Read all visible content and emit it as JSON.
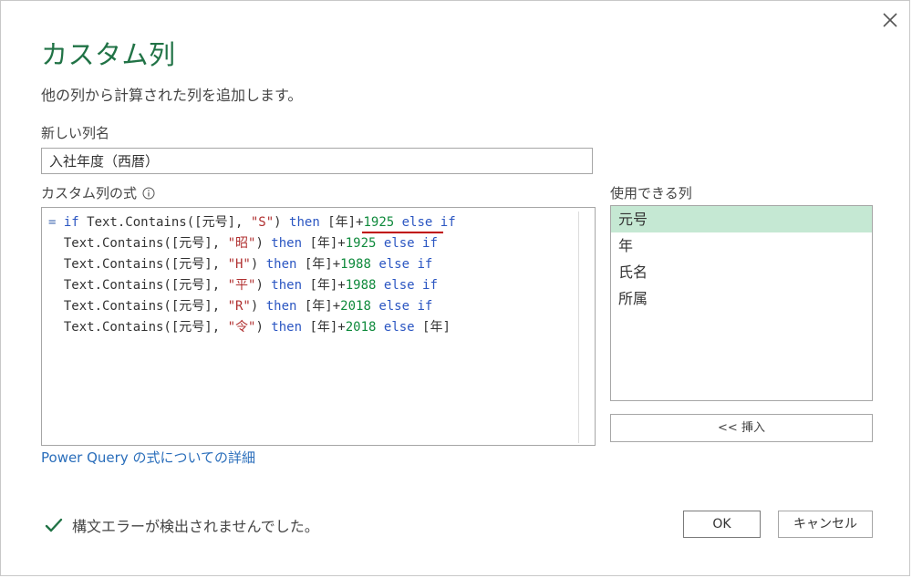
{
  "dialog": {
    "title": "カスタム列",
    "subtitle": "他の列から計算された列を追加します。",
    "new_column_label": "新しい列名",
    "new_column_value": "入社年度（西暦）",
    "formula_label": "カスタム列の式",
    "available_columns_label": "使用できる列",
    "insert_label": "<< 挿入",
    "help_link": "Power Query の式についての詳細",
    "status": "構文エラーが検出されませんでした。",
    "ok_label": "OK",
    "cancel_label": "キャンセル"
  },
  "formula": {
    "lines": [
      [
        "= ",
        "if",
        " Text.Contains([元号], ",
        "\"S\"",
        ") ",
        "then",
        " [年]+",
        "1925",
        " ",
        "else if",
        ""
      ],
      [
        "  Text.Contains([元号], ",
        "\"昭\"",
        ") ",
        "then",
        " [年]+",
        "1925",
        " ",
        "else if"
      ],
      [
        "  Text.Contains([元号], ",
        "\"H\"",
        ") ",
        "then",
        " [年]+",
        "1988",
        " ",
        "else if"
      ],
      [
        "  Text.Contains([元号], ",
        "\"平\"",
        ") ",
        "then",
        " [年]+",
        "1988",
        " ",
        "else if"
      ],
      [
        "  Text.Contains([元号], ",
        "\"R\"",
        ") ",
        "then",
        " [年]+",
        "2018",
        " ",
        "else if"
      ],
      [
        "  Text.Contains([元号], ",
        "\"令\"",
        ") ",
        "then",
        " [年]+",
        "2018",
        " ",
        "else",
        " [年]"
      ]
    ]
  },
  "available_columns": [
    "元号",
    "年",
    "氏名",
    "所属"
  ],
  "selected_column": "元号",
  "icons": {
    "close": "close-icon",
    "info": "info-icon",
    "check": "check-icon"
  },
  "colors": {
    "title": "#217346",
    "keyword": "#2b56c2",
    "string": "#b03030",
    "number": "#0f8a3c",
    "selected_row": "#c5e8d3",
    "link": "#2a6ebb",
    "check": "#217346",
    "error_underline": "#c00000"
  }
}
